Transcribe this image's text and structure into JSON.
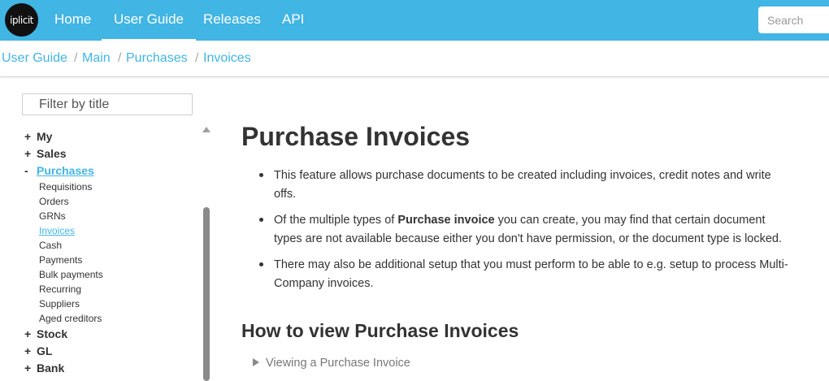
{
  "logo": {
    "text": "iplicit"
  },
  "nav": {
    "items": [
      "Home",
      "User Guide",
      "Releases",
      "API"
    ],
    "search_placeholder": "Search"
  },
  "breadcrumb": [
    "User Guide",
    "Main",
    "Purchases",
    "Invoices"
  ],
  "sidebar": {
    "filter_placeholder": "Filter by title",
    "items": [
      {
        "toggle": "+",
        "label": "My"
      },
      {
        "toggle": "+",
        "label": "Sales"
      },
      {
        "toggle": "-",
        "label": "Purchases",
        "children": [
          "Requisitions",
          "Orders",
          "GRNs",
          "Invoices",
          "Cash",
          "Payments",
          "Bulk payments",
          "Recurring",
          "Suppliers",
          "Aged creditors"
        ]
      },
      {
        "toggle": "+",
        "label": "Stock"
      },
      {
        "toggle": "+",
        "label": "GL"
      },
      {
        "toggle": "+",
        "label": "Bank"
      }
    ],
    "active_child": "Invoices"
  },
  "main": {
    "title": "Purchase Invoices",
    "bullets": [
      {
        "lines": [
          "This feature allows purchase documents to be created including invoices, credit notes and write",
          "offs."
        ]
      },
      {
        "lines": [
          "Of the multiple types of ",
          "Purchase invoice",
          " you can create, you may find that certain document",
          "types are not available because either you don't have permission, or the document type is locked."
        ]
      },
      {
        "lines": [
          "There may also be additional setup that you must perform to be able to e.g. setup to process Multi-",
          "Company invoices."
        ]
      }
    ],
    "section_heading": "How to view Purchase Invoices",
    "details_summary": "Viewing a Purchase Invoice"
  },
  "colors": {
    "brand": "#41b5e4",
    "text": "#333333"
  }
}
